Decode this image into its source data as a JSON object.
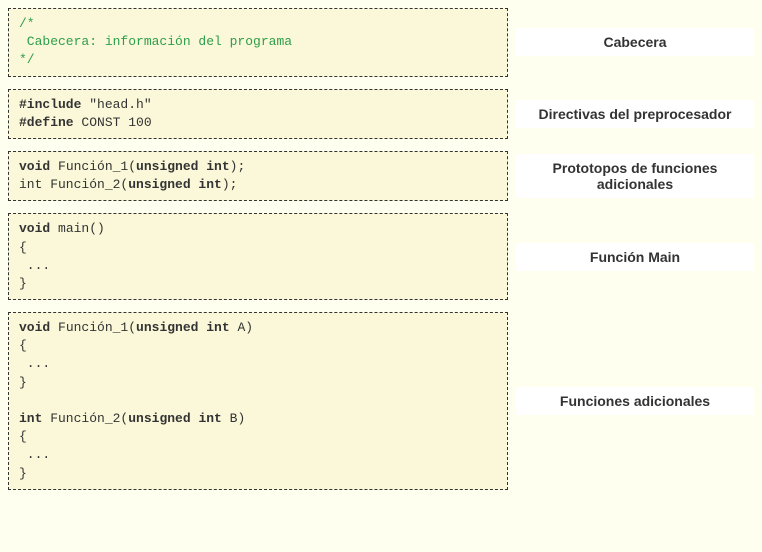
{
  "sections": [
    {
      "code_html": "<span class='comment'>/*<br>&nbsp;Cabecera: información del programa<br>*/</span>",
      "label": "Cabecera"
    },
    {
      "code_html": "<span class='keyword'>#include</span> \"head.h\"<br><span class='keyword'>#define</span> CONST 100",
      "label": "Directivas del preprocesador"
    },
    {
      "code_html": "<span class='keyword'>void</span> Función_1(<span class='keyword'>unsigned int</span>);<br>int Función_2(<span class='keyword'>unsigned int</span>);",
      "label": "Prototopos de funciones adicionales"
    },
    {
      "code_html": "<span class='keyword'>void</span> main()<br>{<br>&nbsp;...<br>}",
      "label": "Función Main"
    },
    {
      "code_html": "<span class='keyword'>void</span> Función_1(<span class='keyword'>unsigned int</span> A)<br>{<br>&nbsp;...<br>}<br><br><span class='keyword'>int</span> Función_2(<span class='keyword'>unsigned int</span> B)<br>{<br>&nbsp;...<br>}",
      "label": "Funciones adicionales"
    }
  ]
}
